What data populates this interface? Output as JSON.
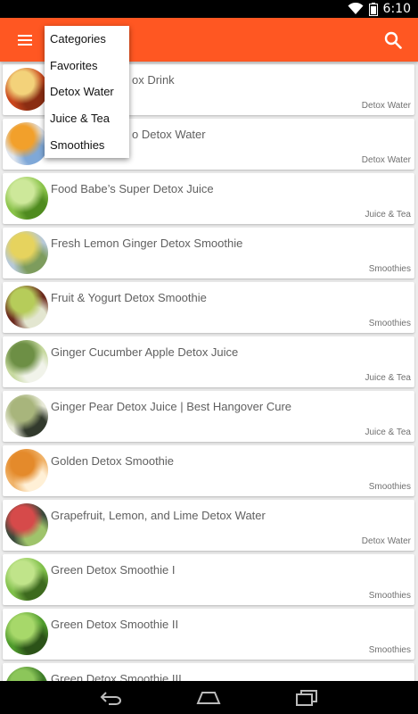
{
  "status_bar": {
    "time": "6:10"
  },
  "app_bar": {
    "color": "#ff5722"
  },
  "dropdown": {
    "items": [
      "Categories",
      "Favorites",
      "Detox Water",
      "Juice & Tea",
      "Smoothies"
    ]
  },
  "recipes": [
    {
      "title": "Apple Cider Vinegar Detox Drink",
      "visible_title": "ox Drink",
      "category": "Detox Water",
      "thumb_colors": [
        "#c9471d",
        "#f3d27a",
        "#8b2d12"
      ]
    },
    {
      "title": "Apple Cinnamon Crockpo Detox Water",
      "visible_title": "o Detox Water",
      "category": "Detox Water",
      "thumb_colors": [
        "#e0e6ef",
        "#f2a02b",
        "#7fa8d8"
      ]
    },
    {
      "title": "Food Babe’s Super Detox Juice",
      "category": "Juice & Tea",
      "thumb_colors": [
        "#8ac34a",
        "#cde89a",
        "#4f8b1f"
      ]
    },
    {
      "title": "Fresh Lemon Ginger Detox Smoothie",
      "category": "Smoothies",
      "thumb_colors": [
        "#b7c9d8",
        "#e6d35e",
        "#7d9c5d"
      ]
    },
    {
      "title": "Fruit & Yogurt Detox Smoothie",
      "category": "Smoothies",
      "thumb_colors": [
        "#6b2a1e",
        "#b6cc5a",
        "#e3e6d0"
      ]
    },
    {
      "title": "Ginger Cucumber Apple Detox Juice",
      "category": "Juice & Tea",
      "thumb_colors": [
        "#c7d9a0",
        "#6d8f45",
        "#f1f3ea"
      ]
    },
    {
      "title": "Ginger Pear Detox Juice | Best Hangover Cure",
      "category": "Juice & Tea",
      "thumb_colors": [
        "#e8ead9",
        "#a8b57c",
        "#323a2d"
      ]
    },
    {
      "title": "Golden Detox Smoothie",
      "category": "Smoothies",
      "thumb_colors": [
        "#f0b36a",
        "#e48a2b",
        "#fff0d6"
      ]
    },
    {
      "title": "Grapefruit, Lemon, and Lime Detox Water",
      "category": "Detox Water",
      "thumb_colors": [
        "#3c4a3c",
        "#d64a4a",
        "#9fc46b"
      ]
    },
    {
      "title": "Green Detox Smoothie I",
      "category": "Smoothies",
      "thumb_colors": [
        "#7fbf4a",
        "#c0e48a",
        "#3d6a1e"
      ]
    },
    {
      "title": "Green Detox Smoothie II",
      "category": "Smoothies",
      "thumb_colors": [
        "#4f9b2c",
        "#a7d86a",
        "#2b5218"
      ]
    },
    {
      "title": "Green Detox Smoothie III",
      "category": "",
      "thumb_colors": [
        "#3f7d28",
        "#8cc65a",
        "#1f3a12"
      ]
    }
  ]
}
